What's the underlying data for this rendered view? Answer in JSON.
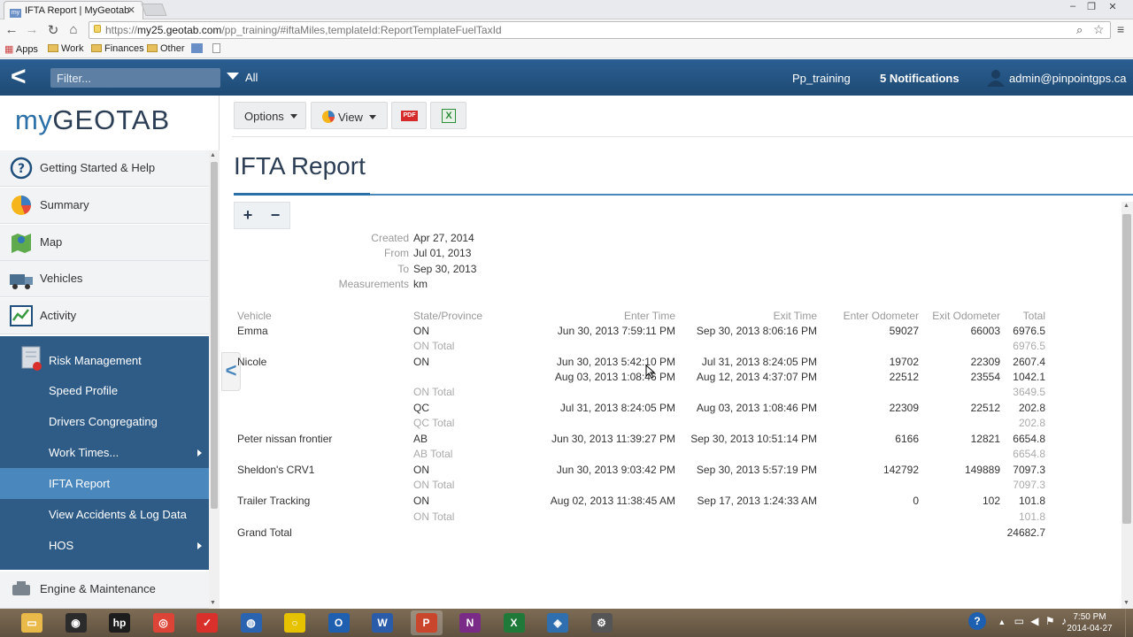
{
  "browser": {
    "tab_title": "IFTA Report | MyGeotab",
    "tab_favicon": "my",
    "url_scheme": "https://",
    "url_domain": "my25.geotab.com",
    "url_path": "/pp_training/#iftaMiles,templateId:ReportTemplateFuelTaxId",
    "bookmarks": [
      "Apps",
      "Work",
      "Finances",
      "Other"
    ]
  },
  "header": {
    "filter_placeholder": "Filter...",
    "all_label": "All",
    "database": "Pp_training",
    "notifications": "5 Notifications",
    "user": "admin@pinpointgps.ca"
  },
  "logo": {
    "prefix": "my",
    "brand": "GEOTAB"
  },
  "nav": {
    "items": [
      "Getting Started & Help",
      "Summary",
      "Map",
      "Vehicles",
      "Activity"
    ],
    "risk_label": "Risk Management",
    "subitems": [
      "Speed Profile",
      "Drivers Congregating",
      "Work Times...",
      "IFTA Report",
      "View Accidents & Log Data",
      "HOS"
    ],
    "bottom_item": "Engine & Maintenance"
  },
  "toolbar": {
    "options_label": "Options",
    "view_label": "View",
    "pdf_label": "PDF",
    "excel_label": "X"
  },
  "page_title": "IFTA Report",
  "meta": {
    "created_label": "Created",
    "created": "Apr 27, 2014",
    "from_label": "From",
    "from": "Jul 01, 2013",
    "to_label": "To",
    "to": "Sep 30, 2013",
    "measurements_label": "Measurements",
    "measurements": "km"
  },
  "table": {
    "headers": [
      "Vehicle",
      "State/Province",
      "Enter Time",
      "Exit Time",
      "Enter Odometer",
      "Exit Odometer",
      "Total"
    ],
    "rows": [
      {
        "vehicle": "Emma",
        "state": "ON",
        "enter": "Jun 30, 2013 7:59:11 PM",
        "exit": "Sep 30, 2013 8:06:16 PM",
        "enter_odo": "59027",
        "exit_odo": "66003",
        "total": "6976.5"
      },
      {
        "subtotal": "ON Total",
        "total": "6976.5"
      },
      {
        "vehicle": "Nicole",
        "state": "ON",
        "enter": "Jun 30, 2013 5:42:10 PM",
        "exit": "Jul 31, 2013 8:24:05 PM",
        "enter_odo": "19702",
        "exit_odo": "22309",
        "total": "2607.4"
      },
      {
        "enter": "Aug 03, 2013 1:08:46 PM",
        "exit": "Aug 12, 2013 4:37:07 PM",
        "enter_odo": "22512",
        "exit_odo": "23554",
        "total": "1042.1"
      },
      {
        "subtotal": "ON Total",
        "total": "3649.5"
      },
      {
        "state": "QC",
        "enter": "Jul 31, 2013 8:24:05 PM",
        "exit": "Aug 03, 2013 1:08:46 PM",
        "enter_odo": "22309",
        "exit_odo": "22512",
        "total": "202.8"
      },
      {
        "subtotal": "QC Total",
        "total": "202.8"
      },
      {
        "vehicle": "Peter nissan frontier",
        "state": "AB",
        "enter": "Jun 30, 2013 11:39:27 PM",
        "exit": "Sep 30, 2013 10:51:14 PM",
        "enter_odo": "6166",
        "exit_odo": "12821",
        "total": "6654.8"
      },
      {
        "subtotal": "AB Total",
        "total": "6654.8"
      },
      {
        "vehicle": "Sheldon's CRV1",
        "state": "ON",
        "enter": "Jun 30, 2013 9:03:42 PM",
        "exit": "Sep 30, 2013 5:57:19 PM",
        "enter_odo": "142792",
        "exit_odo": "149889",
        "total": "7097.3"
      },
      {
        "subtotal": "ON Total",
        "total": "7097.3"
      },
      {
        "vehicle": "Trailer Tracking",
        "state": "ON",
        "enter": "Aug 02, 2013 11:38:45 AM",
        "exit": "Sep 17, 2013 1:24:33 AM",
        "enter_odo": "0",
        "exit_odo": "102",
        "total": "101.8"
      },
      {
        "subtotal": "ON Total",
        "total": "101.8"
      }
    ],
    "grand_total_label": "Grand Total",
    "grand_total": "24682.7"
  },
  "taskbar": {
    "apps": [
      "explorer-icon",
      "media-icon",
      "hp-icon",
      "chrome-icon",
      "todo-icon",
      "globe-icon",
      "ring-icon",
      "outlook-icon",
      "word-icon",
      "powerpoint-icon",
      "onenote-icon",
      "excel-icon",
      "app-icon",
      "tool-icon"
    ],
    "time": "7:50 PM",
    "date": "2014-04-27"
  },
  "colors": {
    "header_blue": "#24537f",
    "subpanel_blue": "#2e5c87",
    "selected_blue": "#4a87bd",
    "title_navy": "#2c3e55"
  }
}
